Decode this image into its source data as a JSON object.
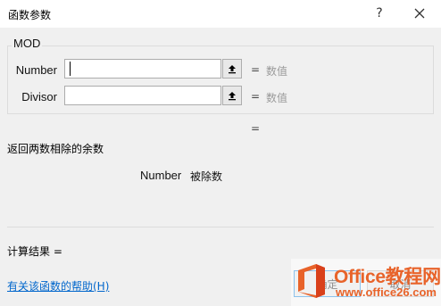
{
  "window": {
    "title": "函数参数",
    "help_label": "?",
    "close_icon": "close-icon"
  },
  "function": {
    "name": "MOD",
    "arguments": [
      {
        "label": "Number",
        "value": "",
        "result_eq": "=",
        "result_hint": "数值"
      },
      {
        "label": "Divisor",
        "value": "",
        "result_eq": "=",
        "result_hint": "数值"
      }
    ],
    "value_eq": "=",
    "description": "返回两数相除的余数",
    "current_argument": {
      "name": "Number",
      "description": "被除数"
    }
  },
  "footer": {
    "result_label": "计算结果 =",
    "help_link": "有关该函数的帮助(H)",
    "ok_label": "确定",
    "cancel_label": "取消"
  },
  "watermark": {
    "brand": "Office教程网",
    "url": "www.office26.com",
    "colors": {
      "orange": "#e8632a",
      "red": "#d9401a"
    }
  }
}
